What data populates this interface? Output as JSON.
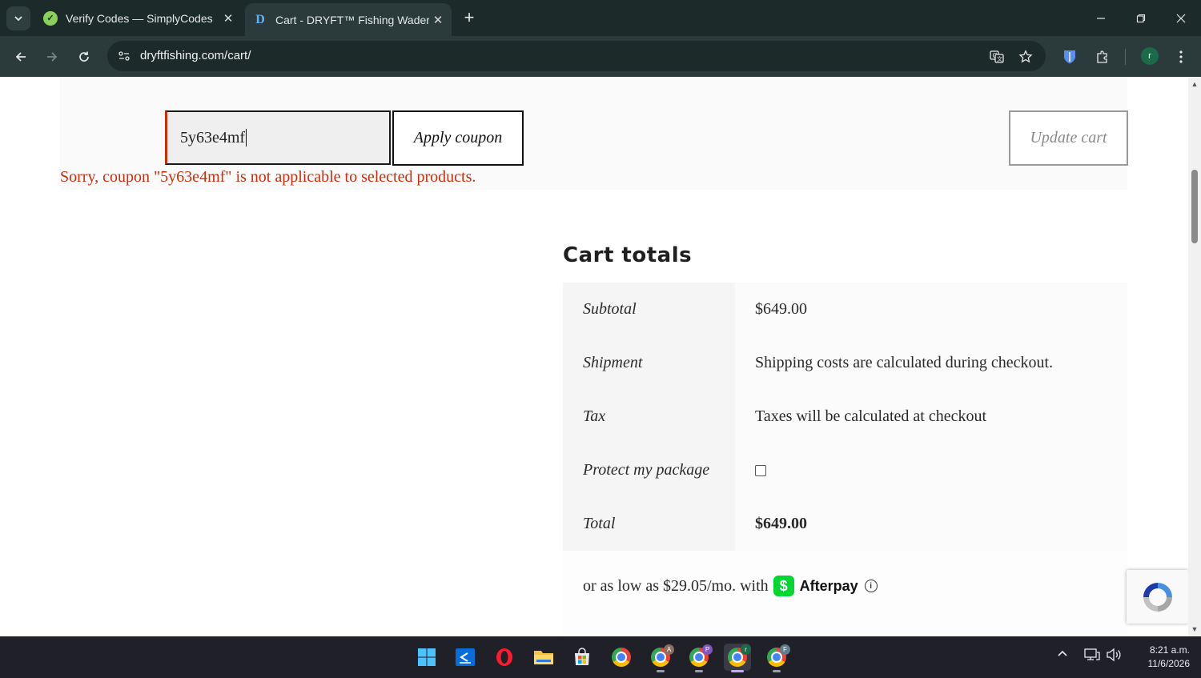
{
  "browser": {
    "tabs": [
      {
        "title": "Verify Codes — SimplyCodes",
        "favicon": "simplycodes-icon",
        "active": false
      },
      {
        "title": "Cart - DRYFT™ Fishing Waders",
        "favicon": "dryft-icon",
        "active": true
      }
    ],
    "new_tab_label": "+",
    "url": "dryftfishing.com/cart/",
    "profile_initial": "r"
  },
  "coupon": {
    "value": "5y63e4mf",
    "apply_label": "Apply coupon",
    "update_label": "Update cart",
    "error": "Sorry, coupon \"5y63e4mf\" is not applicable to selected products."
  },
  "cart_totals": {
    "title": "Cart totals",
    "rows": [
      {
        "label": "Subtotal",
        "value": "$649.00"
      },
      {
        "label": "Shipment",
        "value": "Shipping costs are calculated during checkout."
      },
      {
        "label": "Tax",
        "value": "Taxes will be calculated at checkout"
      },
      {
        "label": "Protect my package",
        "value": ""
      },
      {
        "label": "Total",
        "value": "$649.00"
      }
    ],
    "afterpay": {
      "text": "or as low as $29.05/mo. with",
      "brand": "Afterpay",
      "cash_symbol": "$",
      "info_symbol": "i"
    }
  },
  "taskbar": {
    "badges": [
      "A",
      "P",
      "r",
      "F"
    ],
    "time": "8:21 a.m.",
    "date": "11/6/2026"
  },
  "colors": {
    "chrome_dark": "#1d2a2a",
    "toolbar": "#2b3a3a",
    "error_red": "#cc2d0a",
    "afterpay_green": "#00d632"
  }
}
